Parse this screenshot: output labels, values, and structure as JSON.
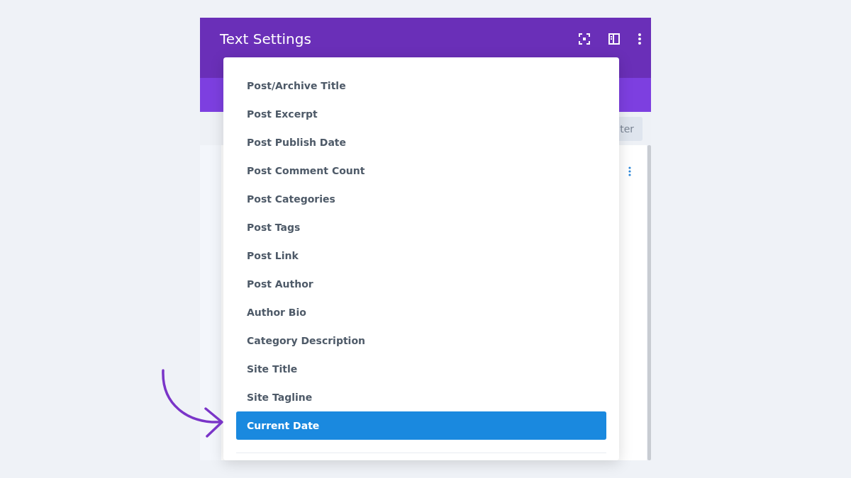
{
  "panel": {
    "title": "Text Settings",
    "button_fragment": "ter"
  },
  "dropdown": {
    "items": [
      {
        "label": "Post/Archive Title",
        "selected": false
      },
      {
        "label": "Post Excerpt",
        "selected": false
      },
      {
        "label": "Post Publish Date",
        "selected": false
      },
      {
        "label": "Post Comment Count",
        "selected": false
      },
      {
        "label": "Post Categories",
        "selected": false
      },
      {
        "label": "Post Tags",
        "selected": false
      },
      {
        "label": "Post Link",
        "selected": false
      },
      {
        "label": "Post Author",
        "selected": false
      },
      {
        "label": "Author Bio",
        "selected": false
      },
      {
        "label": "Category Description",
        "selected": false
      },
      {
        "label": "Site Title",
        "selected": false
      },
      {
        "label": "Site Tagline",
        "selected": false
      },
      {
        "label": "Current Date",
        "selected": true
      }
    ]
  }
}
